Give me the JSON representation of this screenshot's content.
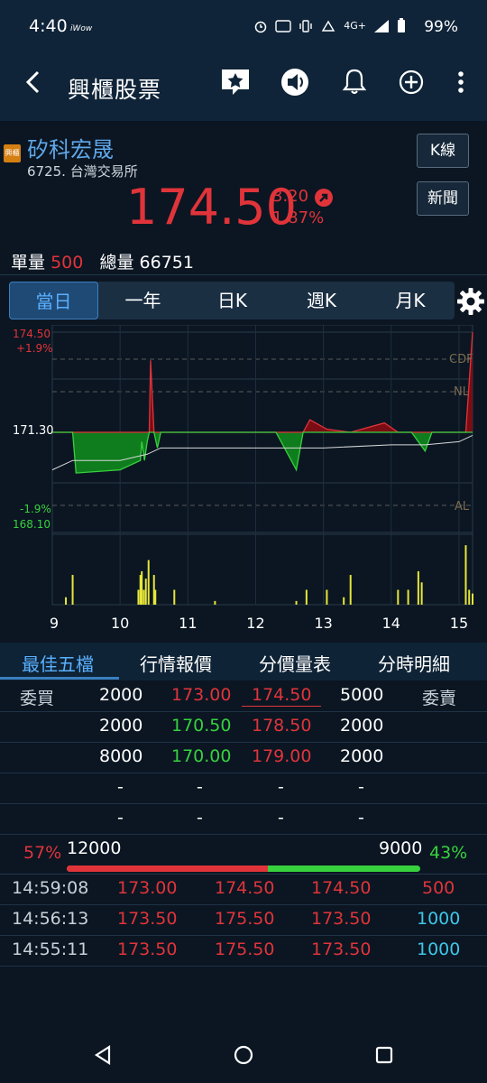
{
  "status": {
    "time": "4:40",
    "brand": "iWow",
    "network": "4G+",
    "battery": "99%"
  },
  "app_bar": {
    "title": "興櫃股票",
    "icons": [
      "back-icon",
      "favorite-star-icon",
      "speaker-icon",
      "bell-icon",
      "add-circle-icon",
      "more-vert-icon"
    ]
  },
  "stock": {
    "badge": "興櫃",
    "name": "矽科宏晟",
    "code_exchange": "6725. 台灣交易所",
    "price": "174.50",
    "change": "3.20",
    "change_pct": "1.87%",
    "kline_button": "K線",
    "news_button": "新聞",
    "unit_vol_label": "單量",
    "unit_vol": "500",
    "total_vol_label": "總量",
    "total_vol": "66751",
    "accent_up": "#e0343a",
    "accent_down": "#37d13e"
  },
  "period_tabs": [
    "當日",
    "一年",
    "日K",
    "週K",
    "月K"
  ],
  "chart": {
    "price_labels": {
      "high_price": "174.50",
      "high_pct": "+1.9%",
      "ref_price": "171.30",
      "low_pct": "-1.9%",
      "low_price": "168.10"
    },
    "ref_lines": [
      "CDF",
      "NL",
      "AL"
    ],
    "x_labels": [
      "9",
      "10",
      "11",
      "12",
      "13",
      "14",
      "15"
    ]
  },
  "chart_data": {
    "type": "line",
    "title": "",
    "xlabel": "",
    "ylabel": "",
    "ylim": [
      168.1,
      174.5
    ],
    "reference_price": 171.3,
    "x_ticks": [
      "9",
      "10",
      "11",
      "12",
      "13",
      "14",
      "15"
    ],
    "price_series": {
      "name": "",
      "x": [
        9.0,
        9.3,
        9.35,
        10.0,
        10.3,
        10.32,
        10.36,
        10.4,
        10.43,
        10.45,
        10.5,
        10.55,
        10.6,
        11.0,
        11.2,
        12.3,
        12.6,
        12.7,
        12.8,
        13.05,
        13.4,
        13.9,
        14.1,
        14.3,
        14.5,
        14.6,
        14.7,
        15.0,
        15.1,
        15.2
      ],
      "y": [
        171.3,
        171.3,
        170.0,
        170.1,
        170.4,
        171.0,
        170.4,
        171.0,
        171.3,
        173.6,
        171.3,
        170.8,
        171.3,
        171.3,
        171.3,
        171.3,
        170.1,
        171.3,
        171.7,
        171.4,
        171.3,
        171.6,
        171.3,
        171.3,
        170.7,
        171.3,
        171.3,
        171.3,
        171.3,
        174.5
      ]
    },
    "avg_series": {
      "name": "",
      "x": [
        9.0,
        9.3,
        10.0,
        10.4,
        10.6,
        11.0,
        12.0,
        13.0,
        14.0,
        14.5,
        15.0,
        15.2
      ],
      "y": [
        170.1,
        170.4,
        170.4,
        170.6,
        170.8,
        170.8,
        170.8,
        170.8,
        170.9,
        170.9,
        171.0,
        171.2
      ]
    },
    "volume_series": {
      "name": "",
      "x": [
        9.2,
        9.3,
        10.27,
        10.3,
        10.32,
        10.35,
        10.38,
        10.42,
        10.5,
        10.52,
        10.8,
        11.4,
        12.6,
        12.75,
        13.05,
        13.3,
        13.4,
        14.1,
        14.25,
        14.4,
        14.45,
        15.1,
        15.15,
        15.2
      ],
      "y": [
        10,
        40,
        20,
        40,
        45,
        20,
        35,
        60,
        40,
        20,
        20,
        5,
        5,
        20,
        20,
        10,
        40,
        20,
        20,
        45,
        30,
        80,
        20,
        15
      ]
    },
    "grid": true,
    "legend": "none"
  },
  "bottom_tabs": [
    "最佳五檔",
    "行情報價",
    "分價量表",
    "分時明細"
  ],
  "order_book": {
    "bid_label": "委買",
    "ask_label": "委賣",
    "rows": [
      {
        "bid_vol": "2000",
        "bid_price": "173.00",
        "ask_price": "174.50",
        "ask_vol": "5000"
      },
      {
        "bid_vol": "2000",
        "bid_price": "170.50",
        "ask_price": "178.50",
        "ask_vol": "2000"
      },
      {
        "bid_vol": "8000",
        "bid_price": "170.00",
        "ask_price": "179.00",
        "ask_vol": "2000"
      },
      {
        "bid_vol": "-",
        "bid_price": "-",
        "ask_price": "-",
        "ask_vol": "-"
      },
      {
        "bid_vol": "-",
        "bid_price": "-",
        "ask_price": "-",
        "ask_vol": "-"
      }
    ],
    "bid_pct": "57%",
    "bid_total": "12000",
    "ask_total": "9000",
    "ask_pct": "43%",
    "bid_ratio": 0.57
  },
  "ticks": [
    {
      "time": "14:59:08",
      "bid": "173.00",
      "ask": "174.50",
      "price": "174.50",
      "vol": "500",
      "vol_color": "#e0343a"
    },
    {
      "time": "14:56:13",
      "bid": "173.50",
      "ask": "175.50",
      "price": "173.50",
      "vol": "1000",
      "vol_color": "#3fc6e8"
    },
    {
      "time": "14:55:11",
      "bid": "173.50",
      "ask": "175.50",
      "price": "173.50",
      "vol": "1000",
      "vol_color": "#3fc6e8"
    }
  ]
}
